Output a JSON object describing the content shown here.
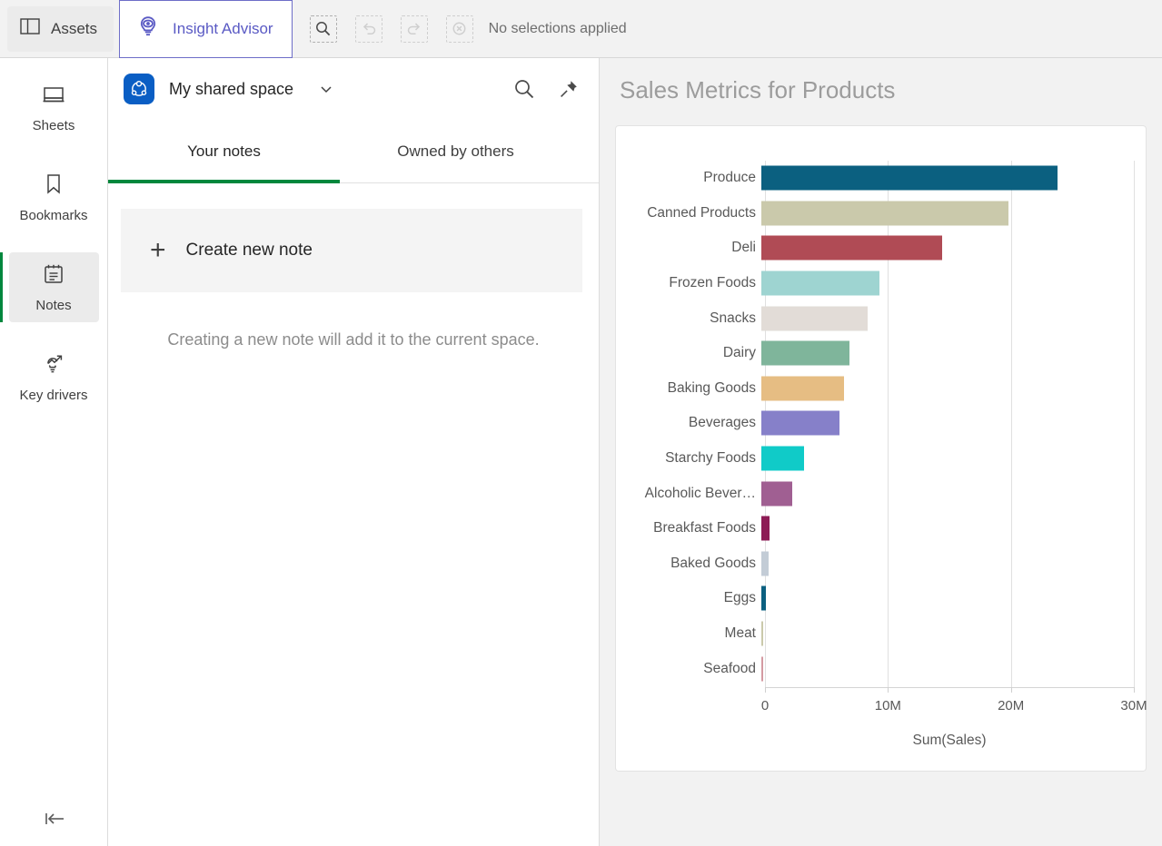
{
  "toolbar": {
    "assets_label": "Assets",
    "insight_label": "Insight Advisor",
    "selection_status": "No selections applied",
    "icons": {
      "smart_search": "search-icon",
      "undo": "undo-icon",
      "redo": "redo-icon",
      "clear": "clear-selections-icon"
    },
    "accent_color": "#00873d",
    "insight_color": "#5a5ac4"
  },
  "rail": {
    "items": [
      {
        "label": "Sheets",
        "icon": "sheets-icon",
        "active": false
      },
      {
        "label": "Bookmarks",
        "icon": "bookmark-icon",
        "active": false
      },
      {
        "label": "Notes",
        "icon": "notes-icon",
        "active": true
      },
      {
        "label": "Key drivers",
        "icon": "key-drivers-icon",
        "active": false
      }
    ],
    "collapse_icon": "collapse-left-icon"
  },
  "notes": {
    "space_name": "My shared space",
    "space_icon": "shared-space-icon",
    "caret_icon": "chevron-down-icon",
    "search_icon": "search-icon",
    "pin_icon": "pin-icon",
    "tabs": [
      {
        "label": "Your notes",
        "active": true
      },
      {
        "label": "Owned by others",
        "active": false
      }
    ],
    "create_label": "Create new note",
    "create_icon": "plus-icon",
    "hint": "Creating a new note will add it to the current space."
  },
  "chart_data": {
    "type": "bar",
    "orientation": "horizontal",
    "title": "Sales Metrics for Products",
    "xlabel": "Sum(Sales)",
    "ylabel": "",
    "xlim": [
      0,
      30000000
    ],
    "xticks": [
      0,
      10000000,
      20000000,
      30000000
    ],
    "xticklabels": [
      "0",
      "10M",
      "20M",
      "30M"
    ],
    "grid": true,
    "legend": false,
    "categories": [
      "Produce",
      "Canned Products",
      "Deli",
      "Frozen Foods",
      "Snacks",
      "Dairy",
      "Baking Goods",
      "Beverages",
      "Starchy Foods",
      "Alcoholic Bever…",
      "Breakfast Foods",
      "Baked Goods",
      "Eggs",
      "Meat",
      "Seafood"
    ],
    "values": [
      24100000,
      20100000,
      14700000,
      9600000,
      8650000,
      7150000,
      6700000,
      6350000,
      3450000,
      2500000,
      700000,
      560000,
      380000,
      140000,
      140000
    ],
    "value_labels": [
      "24.1M",
      "20.1M",
      "14.7M",
      "9.6M",
      "8.65M",
      "7.15M",
      "6.7M",
      "6.35M",
      "3.45M",
      "2.5M",
      "0.7M",
      "0.56M",
      "0.38M",
      "0.14M",
      "0.14M"
    ],
    "colors": [
      "#0b6080",
      "#cac9ab",
      "#b04b55",
      "#9ed4d1",
      "#e2dcd7",
      "#7fb59b",
      "#e6bd83",
      "#8680c9",
      "#10cbc8",
      "#a05f92",
      "#8d1b55",
      "#c3ccd6",
      "#0b6080",
      "#cac9ab",
      "#d49aa2"
    ]
  }
}
